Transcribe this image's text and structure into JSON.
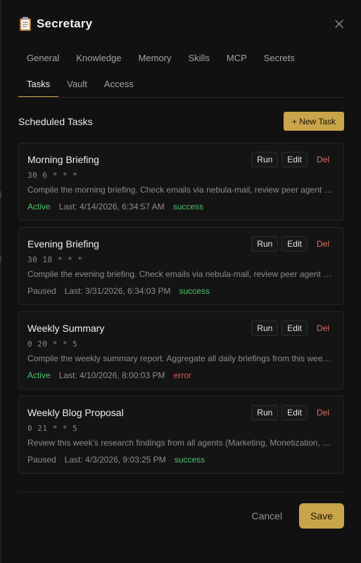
{
  "dialog": {
    "title": "Secretary",
    "title_icon": "clipboard-icon",
    "close_icon": "close-icon"
  },
  "tabs": [
    {
      "label": "General"
    },
    {
      "label": "Knowledge"
    },
    {
      "label": "Memory"
    },
    {
      "label": "Skills"
    },
    {
      "label": "MCP"
    },
    {
      "label": "Secrets"
    },
    {
      "label": "Tasks",
      "active": true
    },
    {
      "label": "Vault"
    },
    {
      "label": "Access"
    }
  ],
  "section": {
    "title": "Scheduled Tasks",
    "new_task_label": "+ New Task"
  },
  "task_actions": {
    "run": "Run",
    "edit": "Edit",
    "del": "Del"
  },
  "tasks": [
    {
      "name": "Morning Briefing",
      "cron": "30 6 * * *",
      "description": "Compile the morning briefing. Check emails via nebula-mail, review peer agent activity and prepare a summary.",
      "status": "Active",
      "last": "Last: 4/14/2026, 6:34:57 AM",
      "result": "success"
    },
    {
      "name": "Evening Briefing",
      "cron": "30 18 * * *",
      "description": "Compile the evening briefing. Check emails via nebula-mail, review peer agent activity and prepare a summary.",
      "status": "Paused",
      "last": "Last: 3/31/2026, 6:34:03 PM",
      "result": "success"
    },
    {
      "name": "Weekly Summary",
      "cron": "0 20 * * 5",
      "description": "Compile the weekly summary report. Aggregate all daily briefings from this week into one document.",
      "status": "Active",
      "last": "Last: 4/10/2026, 8:00:03 PM",
      "result": "error"
    },
    {
      "name": "Weekly Blog Proposal",
      "cron": "0 21 * * 5",
      "description": "Review this week's research findings from all agents (Marketing, Monetization, Product) and propose a blog post.",
      "status": "Paused",
      "last": "Last: 4/3/2026, 9:03:25 PM",
      "result": "success"
    }
  ],
  "footer": {
    "cancel_label": "Cancel",
    "save_label": "Save"
  },
  "colors": {
    "accent": "#c9a44a",
    "success": "#4cc26b",
    "error": "#e0594a",
    "danger": "#e06b5e"
  }
}
